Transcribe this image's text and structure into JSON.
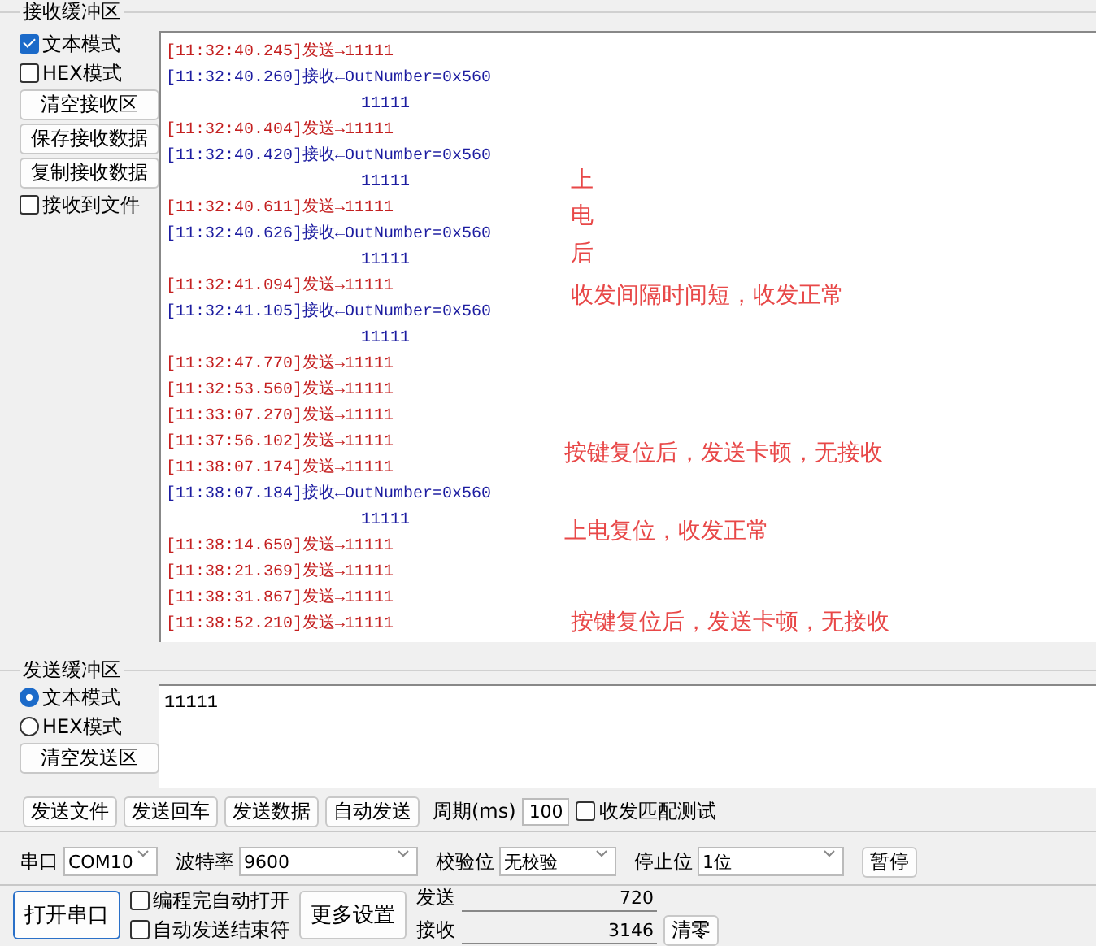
{
  "receive_buffer": {
    "title": "接收缓冲区",
    "options": [
      {
        "kind": "checkbox",
        "label": "文本模式",
        "checked": true
      },
      {
        "kind": "checkbox",
        "label": "HEX模式",
        "checked": false
      },
      {
        "kind": "button",
        "label": "清空接收区"
      },
      {
        "kind": "button",
        "label": "保存接收数据"
      },
      {
        "kind": "button",
        "label": "复制接收数据"
      },
      {
        "kind": "checkbox",
        "label": "接收到文件",
        "checked": false
      }
    ],
    "log": [
      {
        "kind": "send",
        "time": "[11:32:40.245]",
        "text": "发送→11111"
      },
      {
        "kind": "recv",
        "time": "[11:32:40.260]",
        "text": "接收←OutNumber=0x560"
      },
      {
        "kind": "cont",
        "text": "11111"
      },
      {
        "kind": "send",
        "time": "[11:32:40.404]",
        "text": "发送→11111"
      },
      {
        "kind": "recv",
        "time": "[11:32:40.420]",
        "text": "接收←OutNumber=0x560"
      },
      {
        "kind": "cont",
        "text": "11111"
      },
      {
        "kind": "send",
        "time": "[11:32:40.611]",
        "text": "发送→11111"
      },
      {
        "kind": "recv",
        "time": "[11:32:40.626]",
        "text": "接收←OutNumber=0x560"
      },
      {
        "kind": "cont",
        "text": "11111"
      },
      {
        "kind": "send",
        "time": "[11:32:41.094]",
        "text": "发送→11111"
      },
      {
        "kind": "recv",
        "time": "[11:32:41.105]",
        "text": "接收←OutNumber=0x560"
      },
      {
        "kind": "cont",
        "text": "11111"
      },
      {
        "kind": "send",
        "time": "[11:32:47.770]",
        "text": "发送→11111"
      },
      {
        "kind": "send",
        "time": "[11:32:53.560]",
        "text": "发送→11111"
      },
      {
        "kind": "send",
        "time": "[11:33:07.270]",
        "text": "发送→11111"
      },
      {
        "kind": "send",
        "time": "[11:37:56.102]",
        "text": "发送→11111"
      },
      {
        "kind": "send",
        "time": "[11:38:07.174]",
        "text": "发送→11111"
      },
      {
        "kind": "recv",
        "time": "[11:38:07.184]",
        "text": "接收←OutNumber=0x560"
      },
      {
        "kind": "cont",
        "text": "11111"
      },
      {
        "kind": "send",
        "time": "[11:38:14.650]",
        "text": "发送→11111"
      },
      {
        "kind": "send",
        "time": "[11:38:21.369]",
        "text": "发送→11111"
      },
      {
        "kind": "send",
        "time": "[11:38:31.867]",
        "text": "发送→11111"
      },
      {
        "kind": "send",
        "time": "[11:38:52.210]",
        "text": "发送→11111"
      }
    ],
    "annotations": [
      {
        "kind": "vertical",
        "text": "上电后"
      },
      {
        "kind": "line",
        "text": "收发间隔时间短，收发正常"
      },
      {
        "kind": "line",
        "text": "按键复位后，发送卡顿，无接收"
      },
      {
        "kind": "line",
        "text": "上电复位，收发正常"
      },
      {
        "kind": "line",
        "text": "按键复位后，发送卡顿，无接收"
      }
    ]
  },
  "send_buffer": {
    "title": "发送缓冲区",
    "modes": [
      {
        "label": "文本模式",
        "selected": true
      },
      {
        "label": "HEX模式",
        "selected": false
      }
    ],
    "clear_button": "清空发送区",
    "value": "11111"
  },
  "actions": {
    "buttons": [
      "发送文件",
      "发送回车",
      "发送数据",
      "自动发送"
    ],
    "period_label": "周期(ms)",
    "period": "100",
    "match_test": {
      "label": "收发匹配测试",
      "checked": false
    }
  },
  "serial": [
    {
      "label": "串口",
      "value": "COM10"
    },
    {
      "label": "波特率",
      "value": "9600"
    },
    {
      "label": "校验位",
      "value": "无校验"
    },
    {
      "label": "停止位",
      "value": "1位"
    }
  ],
  "pause_button": "暂停",
  "open_button": "打开串口",
  "auto_options": [
    {
      "label": "编程完自动打开",
      "checked": false
    },
    {
      "label": "自动发送结束符",
      "checked": false
    }
  ],
  "more_button": "更多设置",
  "counters": [
    {
      "label": "发送",
      "value": "720"
    },
    {
      "label": "接收",
      "value": "3146"
    }
  ],
  "reset_button": "清零"
}
